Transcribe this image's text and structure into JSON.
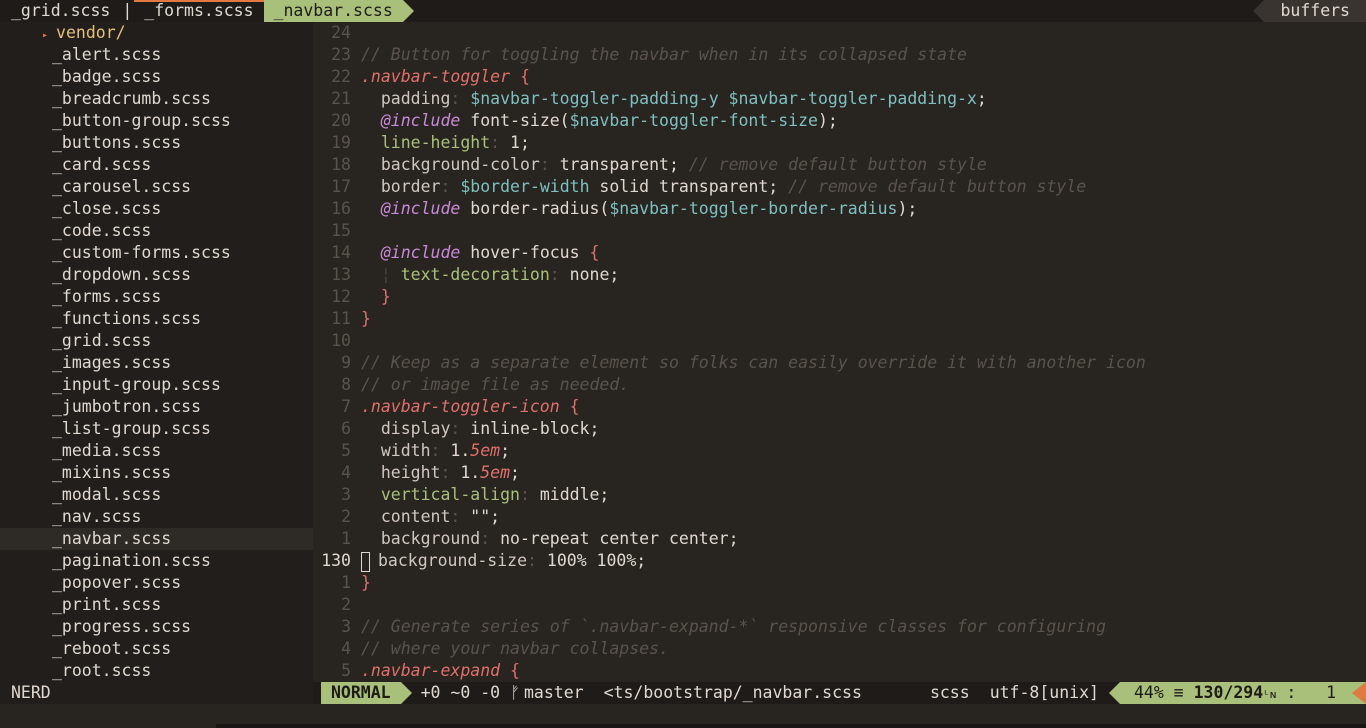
{
  "tabline": {
    "tabs": [
      {
        "label": "_grid.scss"
      },
      {
        "label": "|"
      },
      {
        "label": "_forms.scss"
      },
      {
        "label": "_navbar.scss"
      }
    ],
    "buffers_label": "buffers"
  },
  "tree": {
    "folder": "vendor/",
    "files": [
      "_alert.scss",
      "_badge.scss",
      "_breadcrumb.scss",
      "_button-group.scss",
      "_buttons.scss",
      "_card.scss",
      "_carousel.scss",
      "_close.scss",
      "_code.scss",
      "_custom-forms.scss",
      "_dropdown.scss",
      "_forms.scss",
      "_functions.scss",
      "_grid.scss",
      "_images.scss",
      "_input-group.scss",
      "_jumbotron.scss",
      "_list-group.scss",
      "_media.scss",
      "_mixins.scss",
      "_modal.scss",
      "_nav.scss",
      "_navbar.scss",
      "_pagination.scss",
      "_popover.scss",
      "_print.scss",
      "_progress.scss",
      "_reboot.scss",
      "_root.scss"
    ]
  },
  "editor": {
    "numbers": [
      "24",
      "23",
      "22",
      "21",
      "20",
      "19",
      "18",
      "17",
      "16",
      "15",
      "14",
      "13",
      "12",
      "11",
      "10",
      "9",
      "8",
      "7",
      "6",
      "5",
      "4",
      "3",
      "2",
      "1",
      "130",
      "1",
      "2",
      "3",
      "4",
      "5"
    ],
    "lines": [
      [],
      [
        [
          "comment",
          "// Button for toggling the navbar when in its collapsed state"
        ]
      ],
      [
        [
          "sel",
          ".navbar-toggler"
        ],
        [
          "brace",
          " {"
        ]
      ],
      [
        [
          "prop",
          "  padding"
        ],
        [
          "colon",
          ": "
        ],
        [
          "var",
          "$navbar-toggler-padding-y $navbar-toggler-padding-x"
        ],
        [
          "val",
          ";"
        ]
      ],
      [
        [
          "at",
          "  @include"
        ],
        [
          "val",
          " font-size("
        ],
        [
          "var",
          "$navbar-toggler-font-size"
        ],
        [
          "val",
          ");"
        ]
      ],
      [
        [
          "propalt",
          "  line-height"
        ],
        [
          "colon",
          ": "
        ],
        [
          "num",
          "1"
        ],
        [
          "val",
          ";"
        ]
      ],
      [
        [
          "prop",
          "  background-color"
        ],
        [
          "colon",
          ": "
        ],
        [
          "val",
          "transparent; "
        ],
        [
          "comment",
          "// remove default button style"
        ]
      ],
      [
        [
          "prop",
          "  border"
        ],
        [
          "colon",
          ": "
        ],
        [
          "var",
          "$border-width"
        ],
        [
          "val",
          " solid transparent; "
        ],
        [
          "comment",
          "// remove default button style"
        ]
      ],
      [
        [
          "at",
          "  @include"
        ],
        [
          "val",
          " border-radius("
        ],
        [
          "var",
          "$navbar-toggler-border-radius"
        ],
        [
          "val",
          ");"
        ]
      ],
      [],
      [
        [
          "at",
          "  @include"
        ],
        [
          "val",
          " hover-focus "
        ],
        [
          "brace",
          "{"
        ]
      ],
      [
        [
          "guide",
          "  ¦ "
        ],
        [
          "propalt",
          "text-decoration"
        ],
        [
          "colon",
          ": "
        ],
        [
          "val",
          "none;"
        ]
      ],
      [
        [
          "brace",
          "  }"
        ]
      ],
      [
        [
          "brace",
          "}"
        ]
      ],
      [],
      [
        [
          "comment",
          "// Keep as a separate element so folks can easily override it with another icon"
        ]
      ],
      [
        [
          "comment",
          "// or image file as needed."
        ]
      ],
      [
        [
          "sel",
          ".navbar-toggler-icon"
        ],
        [
          "brace",
          " {"
        ]
      ],
      [
        [
          "prop",
          "  display"
        ],
        [
          "colon",
          ": "
        ],
        [
          "val",
          "inline-block;"
        ]
      ],
      [
        [
          "prop",
          "  width"
        ],
        [
          "colon",
          ": "
        ],
        [
          "num",
          "1."
        ],
        [
          "unit",
          "5em"
        ],
        [
          "val",
          ";"
        ]
      ],
      [
        [
          "prop",
          "  height"
        ],
        [
          "colon",
          ": "
        ],
        [
          "num",
          "1."
        ],
        [
          "unit",
          "5em"
        ],
        [
          "val",
          ";"
        ]
      ],
      [
        [
          "propalt",
          "  vertical-align"
        ],
        [
          "colon",
          ": "
        ],
        [
          "val",
          "middle;"
        ]
      ],
      [
        [
          "prop",
          "  content"
        ],
        [
          "colon",
          ": "
        ],
        [
          "str",
          "\"\""
        ],
        [
          "val",
          ";"
        ]
      ],
      [
        [
          "prop",
          "  background"
        ],
        [
          "colon",
          ": "
        ],
        [
          "val",
          "no-repeat center center;"
        ]
      ],
      [
        [
          "cursor",
          ""
        ],
        [
          "prop",
          "background-size"
        ],
        [
          "colon",
          ": "
        ],
        [
          "num",
          "100% 100%"
        ],
        [
          "val",
          ";"
        ]
      ],
      [
        [
          "brace",
          "}"
        ]
      ],
      [],
      [
        [
          "comment",
          "// Generate series of `.navbar-expand-*` responsive classes for configuring"
        ]
      ],
      [
        [
          "comment",
          "// where your navbar collapses."
        ]
      ],
      [
        [
          "sel",
          ".navbar-expand"
        ],
        [
          "brace",
          " {"
        ]
      ]
    ]
  },
  "statusline": {
    "tree_label": "NERD",
    "mode": "NORMAL",
    "git_stats": "+0 ~0 -0",
    "branch_icon": "ᚠ",
    "branch": "master",
    "file": "<ts/bootstrap/_navbar.scss",
    "filetype": "scss",
    "encoding": "utf-8[unix]",
    "percent": "44%",
    "eq": "≡",
    "line_pos": "130/294",
    "ln_icon": "ᴸɴ",
    "col": ":   1"
  }
}
